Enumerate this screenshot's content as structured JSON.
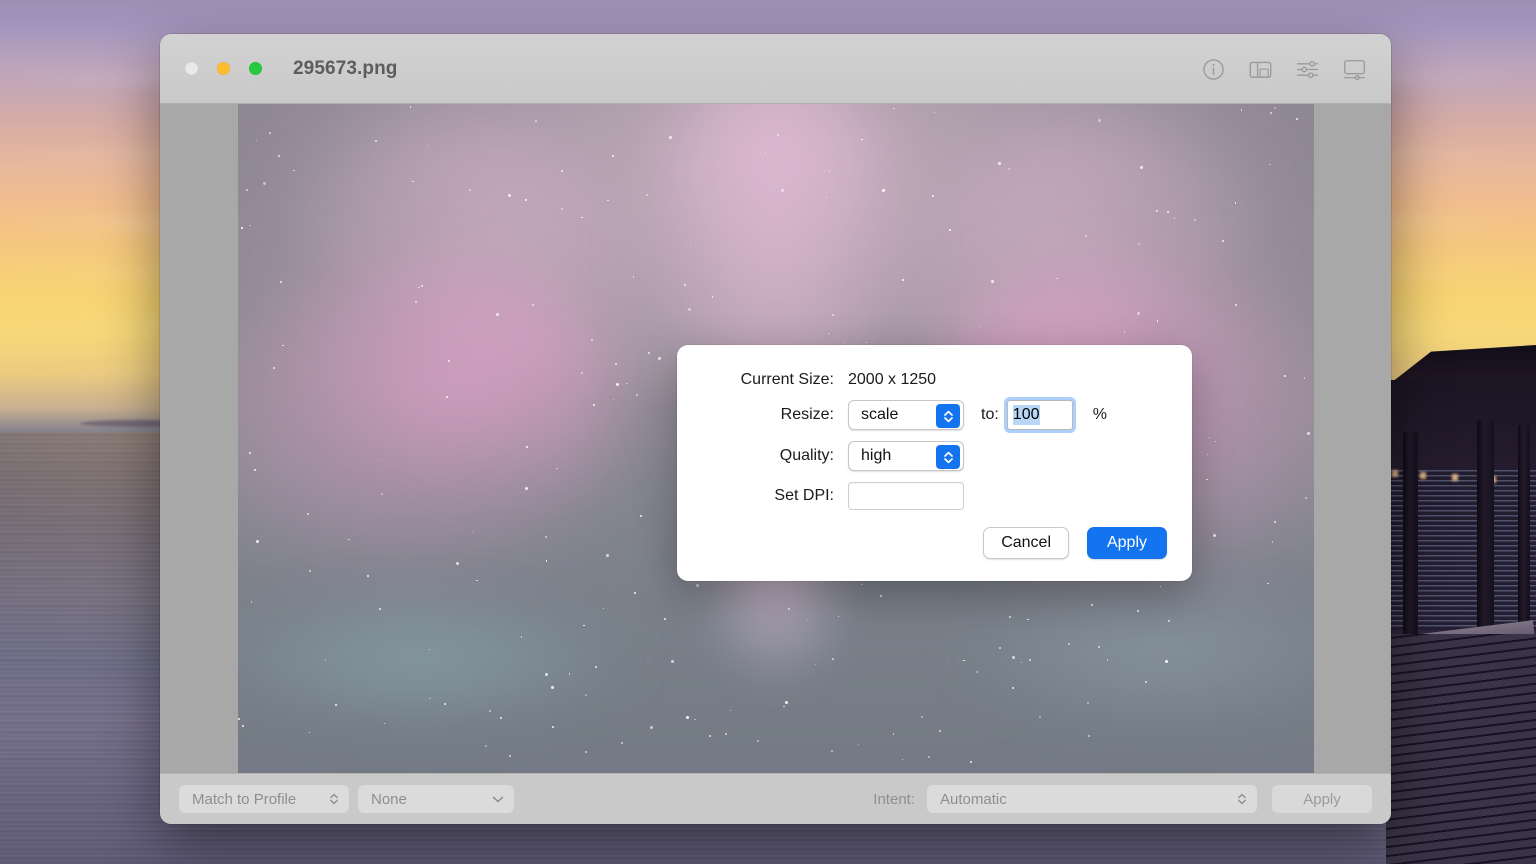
{
  "window": {
    "title": "295673.png",
    "traffic_lights": [
      {
        "name": "close",
        "color": "#e9e9e9"
      },
      {
        "name": "minimize",
        "color": "#febc2e"
      },
      {
        "name": "maximize",
        "color": "#28c840"
      }
    ],
    "toolbar_icons": [
      "info-icon",
      "sidebar-layout-icon",
      "adjustments-sliders-icon",
      "display-icon"
    ]
  },
  "dialog": {
    "current_size_label": "Current Size:",
    "current_size_value": "2000 x 1250",
    "resize_label": "Resize:",
    "resize_value": "scale",
    "to_label": "to:",
    "amount_value": "100",
    "percent_symbol": "%",
    "quality_label": "Quality:",
    "quality_value": "high",
    "dpi_label": "Set DPI:",
    "dpi_value": "",
    "cancel_label": "Cancel",
    "apply_label": "Apply",
    "accent_color": "#1474f0",
    "selection_color": "#b9d6f7"
  },
  "bottom_bar": {
    "match_profile_label": "Match to Profile",
    "profile_value": "None",
    "intent_label": "Intent:",
    "intent_value": "Automatic",
    "apply_label": "Apply"
  }
}
